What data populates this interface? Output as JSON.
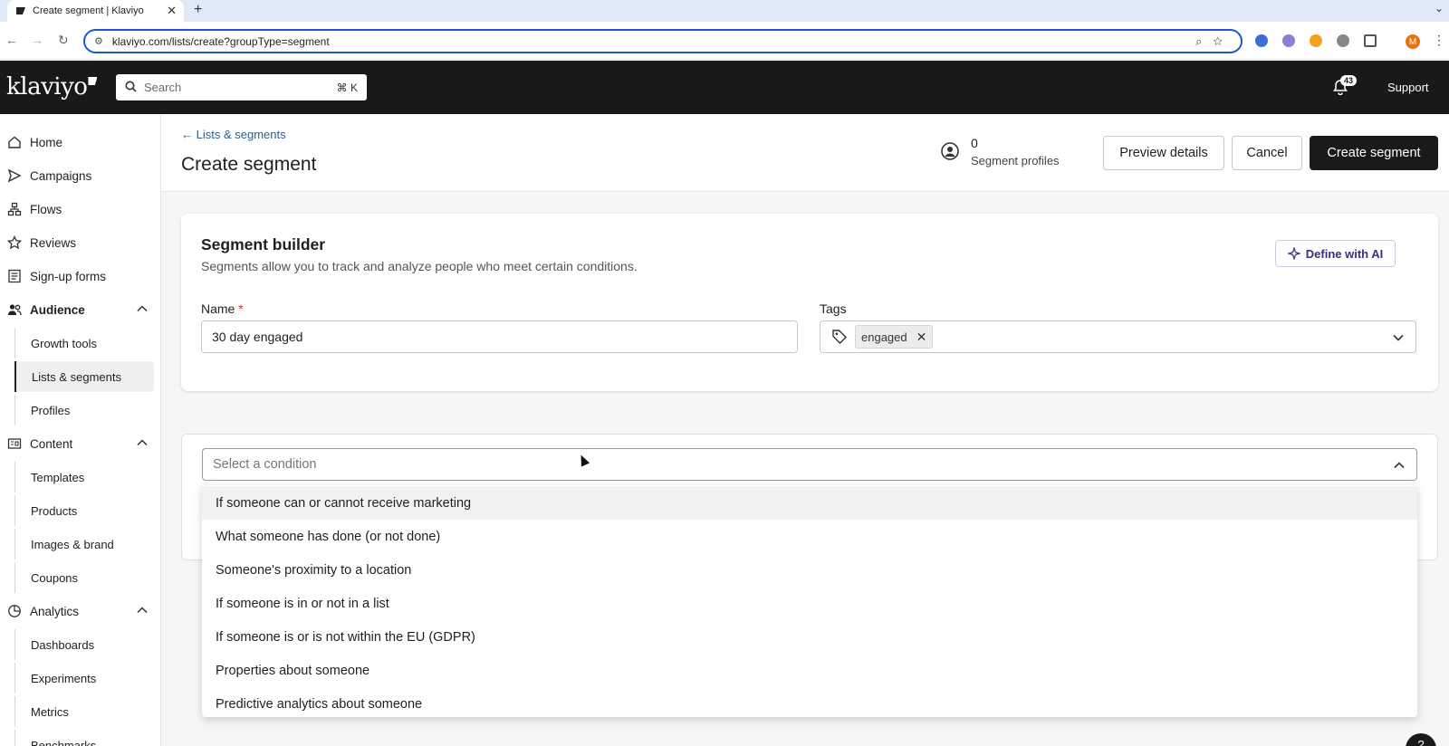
{
  "browser": {
    "tab_title": "Create segment | Klaviyo",
    "url": "klaviyo.com/lists/create?groupType=segment",
    "profile_initial": "M"
  },
  "header": {
    "logo": "klaviyo",
    "search_placeholder": "Search",
    "search_shortcut": "⌘ K",
    "notification_count": "43",
    "support_label": "Support"
  },
  "sidebar": {
    "items": [
      {
        "label": "Home",
        "icon": "home-icon"
      },
      {
        "label": "Campaigns",
        "icon": "send-icon"
      },
      {
        "label": "Flows",
        "icon": "flows-icon"
      },
      {
        "label": "Reviews",
        "icon": "star-icon"
      },
      {
        "label": "Sign-up forms",
        "icon": "form-icon"
      },
      {
        "label": "Audience",
        "icon": "people-icon"
      },
      {
        "label": "Content",
        "icon": "content-icon"
      },
      {
        "label": "Analytics",
        "icon": "pie-chart-icon"
      }
    ],
    "audience_sub": [
      "Growth tools",
      "Lists & segments",
      "Profiles"
    ],
    "content_sub": [
      "Templates",
      "Products",
      "Images & brand",
      "Coupons"
    ],
    "analytics_sub": [
      "Dashboards",
      "Experiments",
      "Metrics",
      "Benchmarks"
    ]
  },
  "page": {
    "back_link": "Lists & segments",
    "title": "Create segment",
    "profile_count": "0",
    "profile_label": "Segment profiles",
    "preview_button": "Preview details",
    "cancel_button": "Cancel",
    "create_button": "Create segment"
  },
  "builder": {
    "title": "Segment builder",
    "description": "Segments allow you to track and analyze people who meet certain conditions.",
    "ai_button": "Define with AI",
    "name_label": "Name",
    "name_required_mark": "*",
    "name_value": "30 day engaged",
    "tags_label": "Tags",
    "tag_chip": "engaged"
  },
  "condition": {
    "placeholder": "Select a condition",
    "options": [
      "If someone can or cannot receive marketing",
      "What someone has done (or not done)",
      "Someone's proximity to a location",
      "If someone is in or not in a list",
      "If someone is or is not within the EU (GDPR)",
      "Properties about someone",
      "Predictive analytics about someone"
    ]
  },
  "colors": {
    "header_bg": "#191919",
    "link": "#2c5e8a",
    "url_focus": "#1a57d6",
    "ai_accent": "#3d2d7a"
  }
}
